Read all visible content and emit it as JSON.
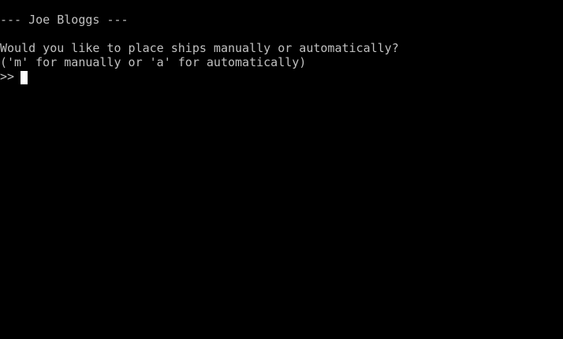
{
  "console": {
    "header": "--- Joe Bloggs ---",
    "question": "Would you like to place ships manually or automatically?",
    "hint": "('m' for manually or 'a' for automatically)",
    "prompt": ">>",
    "input_value": ""
  },
  "colors": {
    "background": "#000000",
    "text": "#c0c0c0",
    "cursor": "#ffffff"
  }
}
